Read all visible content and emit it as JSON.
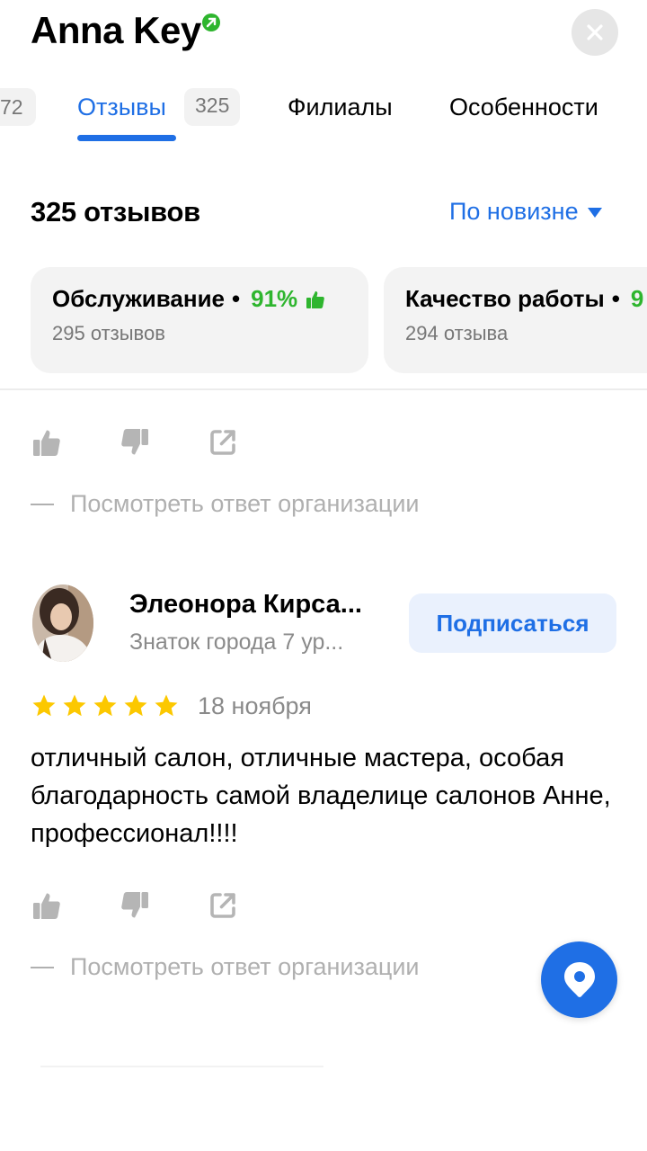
{
  "header": {
    "title": "Anna Key"
  },
  "tabs": {
    "prev_count": "72",
    "active_label": "Отзывы",
    "active_count": "325",
    "branches_label": "Филиалы",
    "features_label": "Особенности"
  },
  "reviews": {
    "count_label": "325 отзывов",
    "sort_label": "По новизне"
  },
  "aspects": [
    {
      "title": "Обслуживание",
      "percent": "91%",
      "sub": "295 отзывов"
    },
    {
      "title": "Качество работы",
      "percent": "9",
      "sub": "294 отзыва"
    }
  ],
  "org_reply_label": "Посмотреть ответ организации",
  "review": {
    "author_name": "Элеонора Кирса...",
    "author_level": "Знаток города 7 ур...",
    "subscribe_label": "Подписаться",
    "rating": 5,
    "date": "18 ноября",
    "text": "отличный салон, отличные мастера, особая благодарность самой владелице салонов Анне, профессионал!!!!"
  },
  "colors": {
    "accent": "#1f6fe5",
    "positive": "#2eb52e",
    "star": "#fcc800"
  }
}
